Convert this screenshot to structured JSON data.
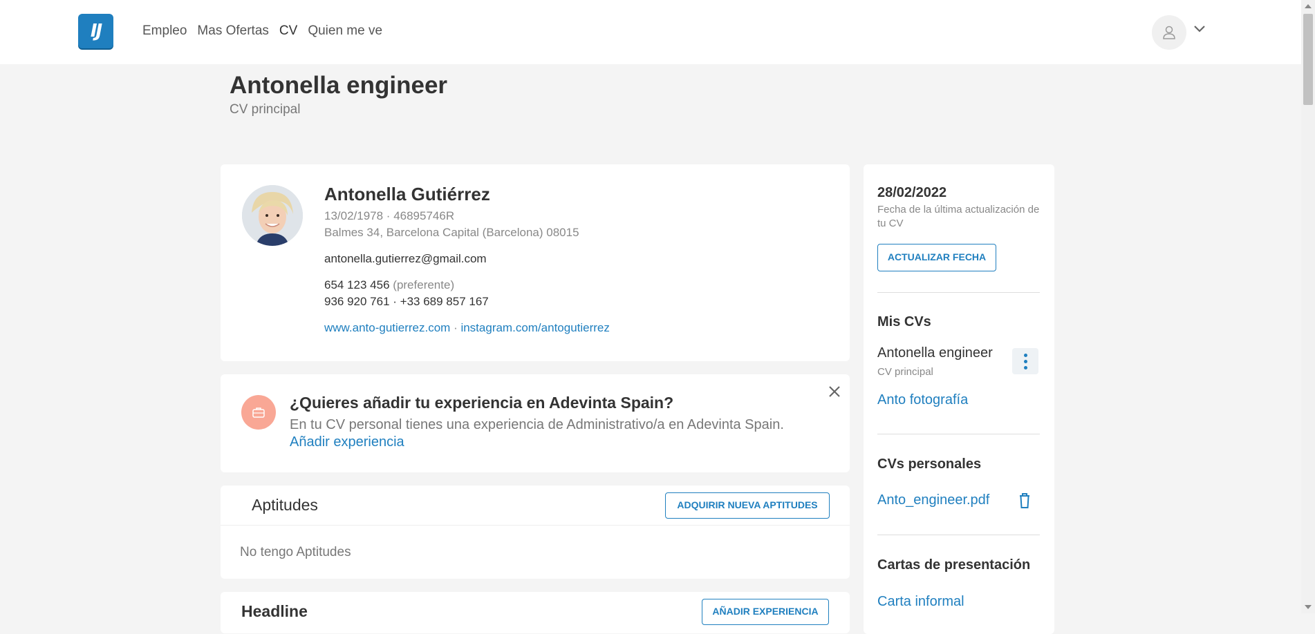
{
  "nav": {
    "logo_text": "IJ",
    "items": [
      {
        "label": "Empleo"
      },
      {
        "label": "Mas Ofertas"
      },
      {
        "label": "CV"
      },
      {
        "label": "Quien me ve"
      }
    ],
    "active": "CV"
  },
  "page": {
    "title": "Antonella engineer",
    "subtitle": "CV principal"
  },
  "profile": {
    "name": "Antonella Gutiérrez",
    "birth_id": "13/02/1978 · 46895746R",
    "address": "Balmes 34, Barcelona Capital (Barcelona) 08015",
    "email": "antonella.gutierrez@gmail.com",
    "phone_primary": "654 123 456",
    "phone_primary_note": "(preferente)",
    "phones_other": "936 920 761 · +33 689 857 167",
    "website": "www.anto-gutierrez.com",
    "separator": " · ",
    "instagram": "instagram.com/antogutierrez"
  },
  "notice": {
    "title": "¿Quieres añadir tu experiencia en Adevinta Spain?",
    "text": "En tu CV personal tienes una experiencia de Administrativo/a en Adevinta Spain.",
    "link": "Añadir experiencia"
  },
  "skills": {
    "title": "Aptitudes",
    "button": "ADQUIRIR NUEVA APTITUDES",
    "empty": "No tengo Aptitudes"
  },
  "headline": {
    "title": "Headline",
    "button": "AÑADIR EXPERIENCIA"
  },
  "sidebar": {
    "date": "28/02/2022",
    "date_note": "Fecha de la última actualización de tu CV",
    "update_button": "ACTUALIZAR FECHA",
    "mis_cvs_title": "Mis CVs",
    "cv_main_name": "Antonella engineer",
    "cv_main_sub": "CV principal",
    "cv_other": "Anto fotografía",
    "personal_title": "CVs personales",
    "personal_file": "Anto_engineer.pdf",
    "letters_title": "Cartas de presentación",
    "letter_1": "Carta informal"
  },
  "colors": {
    "accent": "#1f7fbf",
    "notice_icon": "#f9a795",
    "background": "#f4f4f4"
  }
}
